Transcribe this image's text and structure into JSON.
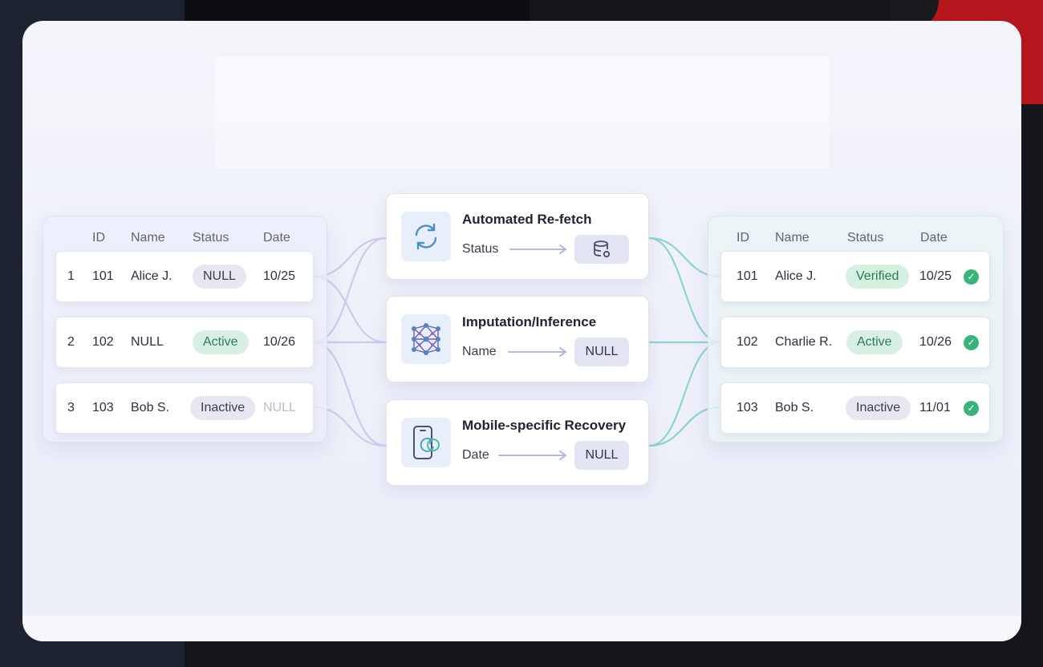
{
  "source_table": {
    "headers": [
      "ID",
      "Name",
      "Status",
      "Date"
    ],
    "rows": [
      {
        "index": "1",
        "id": "101",
        "name": "Alice J.",
        "status": "NULL",
        "date": "10/25"
      },
      {
        "index": "2",
        "id": "102",
        "name": "NULL",
        "status": "Active",
        "date": "10/26"
      },
      {
        "index": "3",
        "id": "103",
        "name": "Bob S.",
        "status": "Inactive",
        "date": "NULL"
      }
    ]
  },
  "methods": [
    {
      "title": "Automated Re-fetch",
      "field": "Status",
      "icon": "refresh-icon",
      "target_icon": "database-icon"
    },
    {
      "title": "Imputation/Inference",
      "field": "Name",
      "icon": "neural-network-icon",
      "target": "NULL"
    },
    {
      "title": "Mobile-specific Recovery",
      "field": "Date",
      "icon": "mobile-sync-icon",
      "target": "NULL"
    }
  ],
  "result_table": {
    "headers": [
      "ID",
      "Name",
      "Status",
      "Date"
    ],
    "rows": [
      {
        "id": "101",
        "name": "Alice J.",
        "status": "Verified",
        "date": "10/25",
        "check": "✓"
      },
      {
        "id": "102",
        "name": "Charlie R.",
        "status": "Active",
        "date": "10/26",
        "check": "✓"
      },
      {
        "id": "103",
        "name": "Bob S.",
        "status": "Inactive",
        "date": "11/01",
        "check": "✓"
      }
    ]
  },
  "colors": {
    "left_connector": "#c9cdee",
    "right_connector": "#8fd3cf",
    "success": "#3ab37a",
    "icon_accent": "#4a8fc9"
  }
}
